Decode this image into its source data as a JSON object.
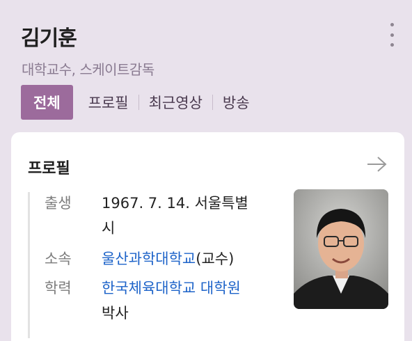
{
  "person": {
    "name": "김기훈",
    "subtitle": "대학교수, 스케이트감독"
  },
  "tabs": [
    {
      "label": "전체",
      "active": true
    },
    {
      "label": "프로필",
      "active": false
    },
    {
      "label": "최근영상",
      "active": false
    },
    {
      "label": "방송",
      "active": false
    }
  ],
  "profile": {
    "title": "프로필",
    "birth": {
      "label": "출생",
      "value_line1": "1967. 7. 14. 서울특별",
      "value_line2": "시"
    },
    "affiliation": {
      "label": "소속",
      "link": "울산과학대학교",
      "suffix": "(교수)"
    },
    "education": {
      "label": "학력",
      "link": "한국체육대학교 대학원",
      "suffix": "박사"
    }
  },
  "colors": {
    "background": "#e9e2ec",
    "active_tab": "#9c6b9c",
    "link": "#1d63c9"
  },
  "icons": {
    "more": "vertical-ellipsis-icon",
    "arrow": "right-arrow-icon",
    "photo": "profile-photo"
  }
}
